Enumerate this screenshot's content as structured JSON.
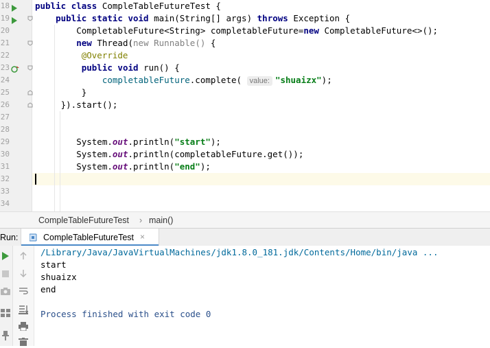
{
  "editor": {
    "line_numbers": [
      "18",
      "19",
      "20",
      "21",
      "22",
      "23",
      "24",
      "25",
      "26",
      "27",
      "28",
      "29",
      "30",
      "31",
      "32",
      "33",
      "34"
    ],
    "lines": [
      [
        {
          "t": "public ",
          "c": "kw"
        },
        {
          "t": "class ",
          "c": "kw"
        },
        {
          "t": "CompleTableFutureTest {",
          "c": "plain"
        }
      ],
      [
        {
          "t": "    public ",
          "c": "kw"
        },
        {
          "t": "static ",
          "c": "kw"
        },
        {
          "t": "void ",
          "c": "kw"
        },
        {
          "t": "main(String[] args) ",
          "c": "plain"
        },
        {
          "t": "throws ",
          "c": "kw"
        },
        {
          "t": "Exception {",
          "c": "plain"
        }
      ],
      [
        {
          "t": "        CompletableFuture<String> completableFuture=",
          "c": "plain"
        },
        {
          "t": "new ",
          "c": "kw"
        },
        {
          "t": "CompletableFuture<>();",
          "c": "plain"
        }
      ],
      [
        {
          "t": "        ",
          "c": "plain"
        },
        {
          "t": "new ",
          "c": "kw"
        },
        {
          "t": "Thread(",
          "c": "plain"
        },
        {
          "t": "new Runnable() ",
          "c": "gray"
        },
        {
          "t": "{",
          "c": "plain"
        }
      ],
      [
        {
          "t": "         @Override",
          "c": "ann"
        }
      ],
      [
        {
          "t": "         public ",
          "c": "kw"
        },
        {
          "t": "void ",
          "c": "kw"
        },
        {
          "t": "run() {",
          "c": "plain"
        }
      ],
      [
        {
          "t": "             completableFuture",
          "c": "mem"
        },
        {
          "t": ".complete( ",
          "c": "plain"
        },
        {
          "t": "value:",
          "c": "hint"
        },
        {
          "t": "\"shuaizx\"",
          "c": "str"
        },
        {
          "t": ");",
          "c": "plain"
        }
      ],
      [
        {
          "t": "         }",
          "c": "plain"
        }
      ],
      [
        {
          "t": "     }).start();",
          "c": "plain"
        }
      ],
      [],
      [],
      [
        {
          "t": "        System.",
          "c": "plain"
        },
        {
          "t": "out",
          "c": "fld"
        },
        {
          "t": ".println(",
          "c": "plain"
        },
        {
          "t": "\"start\"",
          "c": "str"
        },
        {
          "t": ");",
          "c": "plain"
        }
      ],
      [
        {
          "t": "        System.",
          "c": "plain"
        },
        {
          "t": "out",
          "c": "fld"
        },
        {
          "t": ".println(completableFuture.get());",
          "c": "plain"
        }
      ],
      [
        {
          "t": "        System.",
          "c": "plain"
        },
        {
          "t": "out",
          "c": "fld"
        },
        {
          "t": ".println(",
          "c": "plain"
        },
        {
          "t": "\"end\"",
          "c": "str"
        },
        {
          "t": ");",
          "c": "plain"
        }
      ],
      [],
      [],
      []
    ]
  },
  "breadcrumb": {
    "class_name": "CompleTableFutureTest",
    "separator": "›",
    "method": "main()"
  },
  "run_panel": {
    "label": "Run:",
    "tab_label": "CompleTableFutureTest",
    "close_glyph": "×",
    "console": {
      "command": "/Library/Java/JavaVirtualMachines/jdk1.8.0_181.jdk/Contents/Home/bin/java ...",
      "output": [
        "start",
        "shuaizx",
        "end"
      ],
      "exit_message": "Process finished with exit code 0"
    }
  },
  "colors": {
    "keyword": "#000080",
    "string": "#067d17",
    "static_field": "#660e7a",
    "annotation": "#808000",
    "run_green": "#3d9a3d",
    "current_line": "#fdfae8"
  }
}
